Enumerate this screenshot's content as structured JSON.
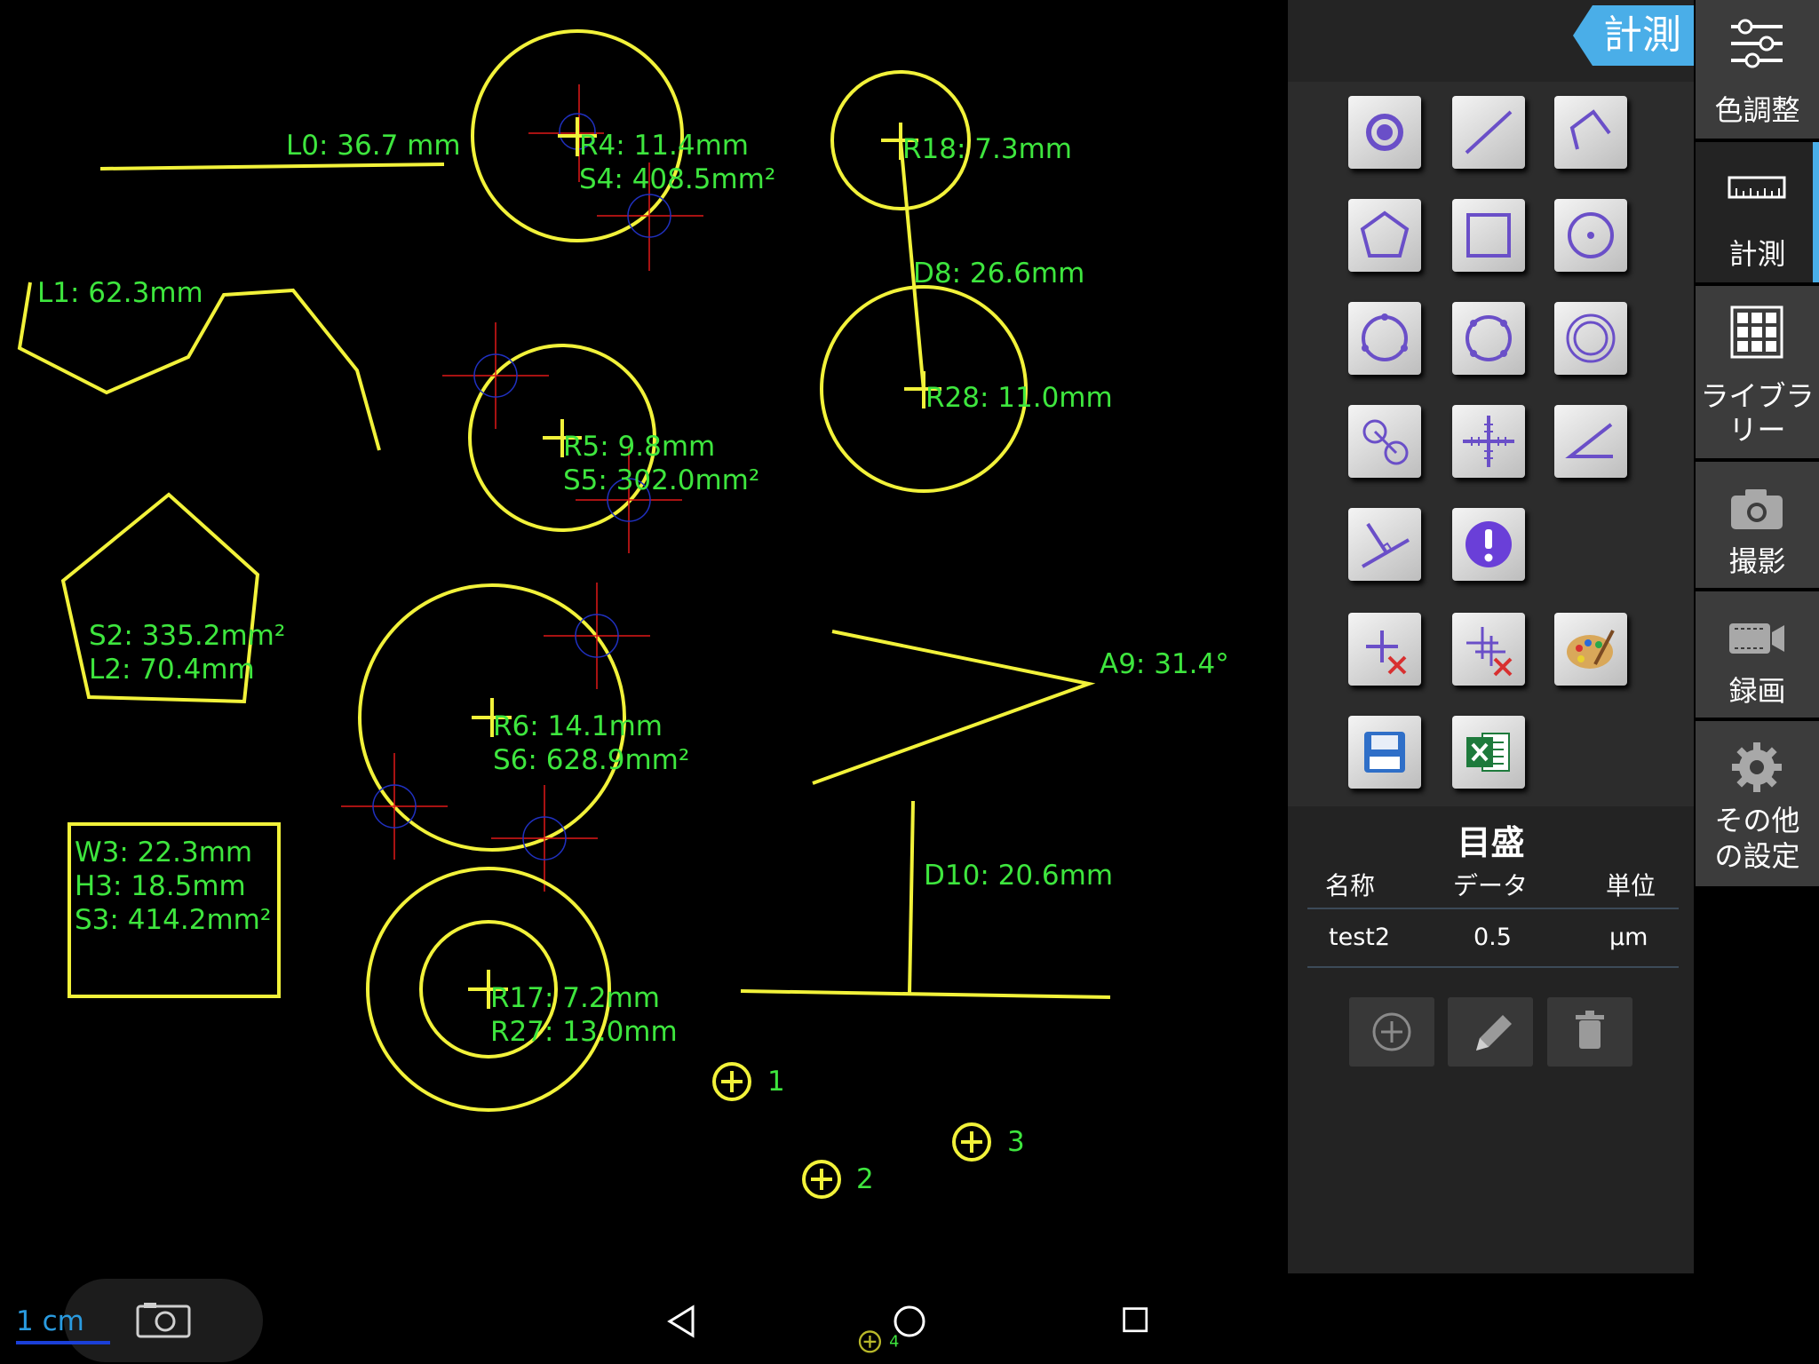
{
  "measurements": {
    "l0": "L0: 36.7 mm",
    "r4": "R4: 11.4mm",
    "s4": "S4: 408.5mm²",
    "r18": "R18: 7.3mm",
    "l1": "L1: 62.3mm",
    "d8": "D8: 26.6mm",
    "r5": "R5: 9.8mm",
    "s5": "S5: 302.0mm²",
    "r28": "R28: 11.0mm",
    "s2": "S2: 335.2mm²",
    "l2": "L2: 70.4mm",
    "r6": "R6: 14.1mm",
    "s6": "S6: 628.9mm²",
    "a9": "A9: 31.4°",
    "w3": "W3: 22.3mm",
    "h3": "H3: 18.5mm",
    "s3": "S3: 414.2mm²",
    "d10": "D10: 20.6mm",
    "r17": "R17: 7.2mm",
    "r27": "R27: 13.0mm"
  },
  "markers": [
    "1",
    "2",
    "3",
    "4"
  ],
  "panel": {
    "tab": "計測",
    "tools": [
      "point-tool",
      "line-tool",
      "polyline-tool",
      "polygon-tool",
      "rectangle-tool",
      "center-circle-tool",
      "three-point-circle-tool",
      "multi-point-circle-tool",
      "concentric-circle-tool",
      "circle-distance-tool",
      "crosshair-tool",
      "angle-tool",
      "perpendicular-tool",
      "info-tool",
      "delete-point-tool",
      "delete-all-tool",
      "palette-tool",
      "save-tool",
      "excel-export-tool"
    ]
  },
  "gauge": {
    "title": "目盛",
    "headers": {
      "name": "名称",
      "data": "データ",
      "unit": "単位"
    },
    "row": {
      "name": "test2",
      "data": "0.5",
      "unit": "μm"
    }
  },
  "sidenav": {
    "color": "色調整",
    "measure": "計測",
    "library_1": "ライブラ",
    "library_2": "リー",
    "capture": "撮影",
    "record": "録画",
    "settings_1": "その他",
    "settings_2": "の設定"
  },
  "scale_label": "1 cm",
  "colors": {
    "shape": "#f2f23a",
    "label": "#3ee63e",
    "accent": "#4aaee8",
    "scale": "#2a9be0"
  }
}
